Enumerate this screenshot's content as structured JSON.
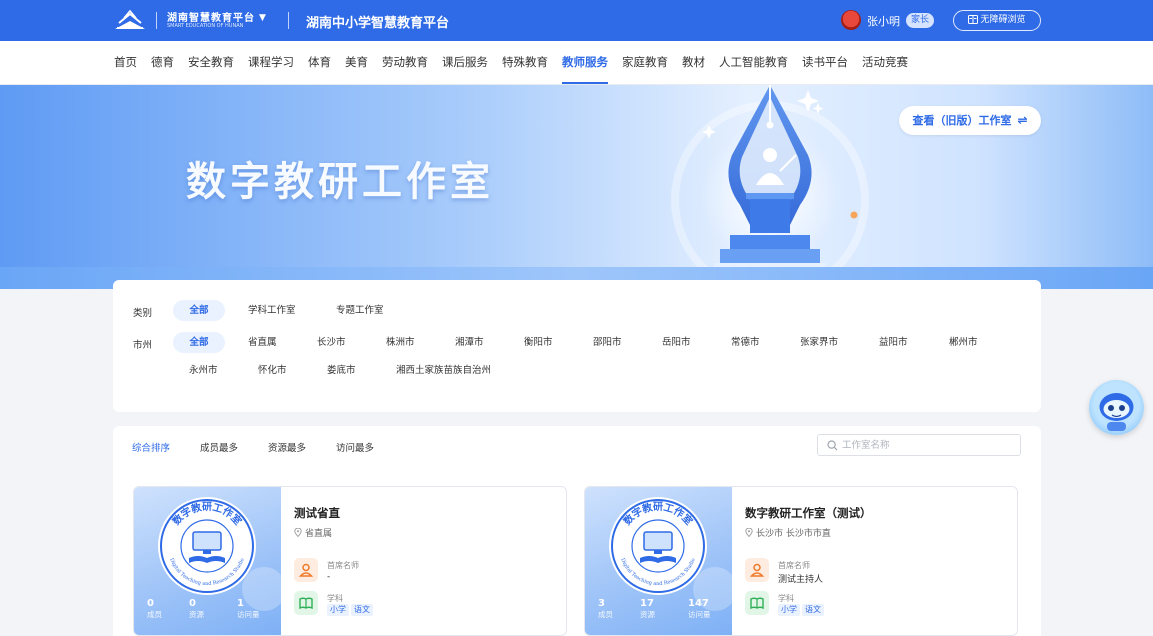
{
  "topbar": {
    "brand_name": "湖南智慧教育平台",
    "brand_en": "SMART EDUCATION OF HUNAN",
    "platform_title": "湖南中小学智慧教育平台",
    "user_name": "张小明",
    "user_role": "家长",
    "accessibility_label": "无障碍浏览",
    "bg_color": "#2f6be6"
  },
  "nav": {
    "items": [
      "首页",
      "德育",
      "安全教育",
      "课程学习",
      "体育",
      "美育",
      "劳动教育",
      "课后服务",
      "特殊教育",
      "教师服务",
      "家庭教育",
      "教材",
      "人工智能教育",
      "读书平台",
      "活动竞赛"
    ],
    "active": "教师服务"
  },
  "banner": {
    "title": "数字教研工作室",
    "old_version_button": "查看（旧版）工作室",
    "switch_icon": "⇌"
  },
  "filters": {
    "category_label": "类别",
    "category_options": [
      "全部",
      "学科工作室",
      "专题工作室"
    ],
    "city_label": "市州",
    "city_options_row1": [
      "全部",
      "省直属",
      "长沙市",
      "株洲市",
      "湘潭市",
      "衡阳市",
      "邵阳市",
      "岳阳市",
      "常德市",
      "张家界市",
      "益阳市",
      "郴州市"
    ],
    "city_options_row2": [
      "永州市",
      "怀化市",
      "娄底市",
      "湘西土家族苗族自治州"
    ]
  },
  "list": {
    "sort_options": [
      "综合排序",
      "成员最多",
      "资源最多",
      "访问最多"
    ],
    "search_placeholder": "工作室名称",
    "stat_labels": {
      "members": "成员",
      "resources": "资源",
      "visits": "访问量"
    },
    "field_labels": {
      "chief": "首席名师",
      "subject": "学科"
    },
    "seal_text": "数字教研工作室",
    "seal_en": "Digital Teaching and Research Studio",
    "studios": [
      {
        "name": "测试省直",
        "location": "省直属",
        "chief": "-",
        "subject_tags": [
          "小学",
          "语文"
        ],
        "members": "0",
        "resources": "0",
        "visits": "1"
      },
      {
        "name": "数字教研工作室（测试）",
        "location": "长沙市 长沙市市直",
        "chief": "测试主持人",
        "subject_tags": [
          "小学",
          "语文"
        ],
        "members": "3",
        "resources": "17",
        "visits": "147"
      }
    ]
  },
  "assistant": {
    "icon": "robot-assistant-icon"
  }
}
